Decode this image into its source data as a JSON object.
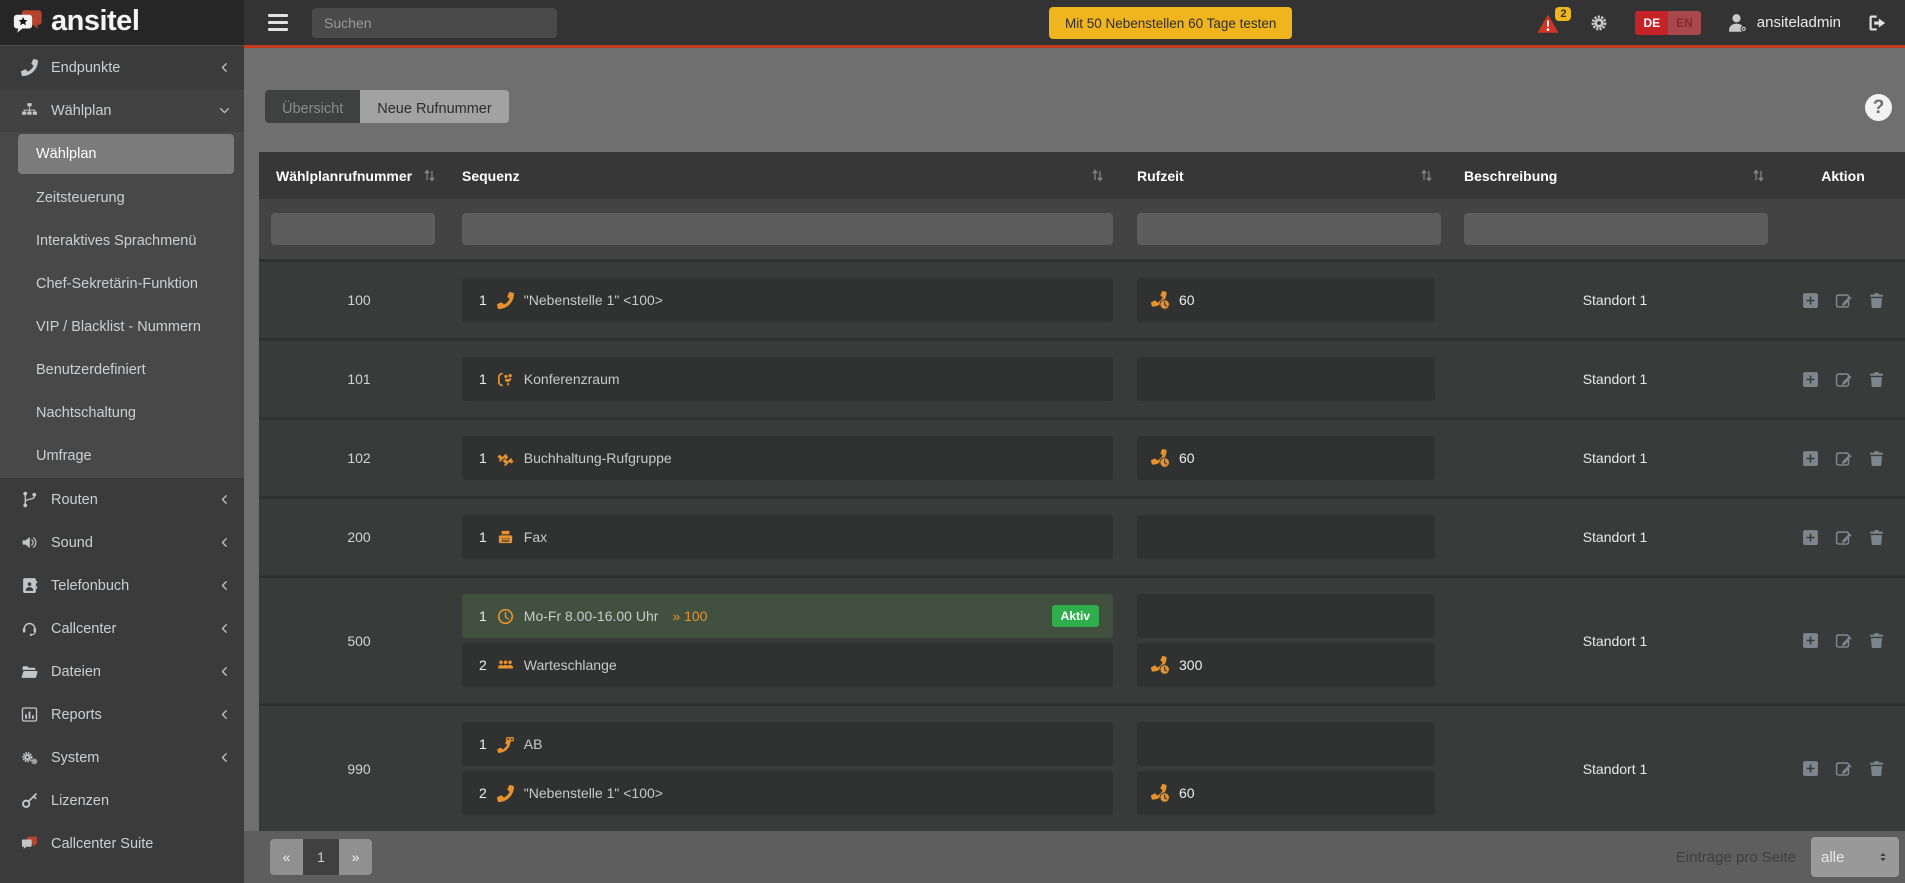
{
  "topbar": {
    "logo_text": "ansitel",
    "search_placeholder": "Suchen",
    "trial_button_label": "Mit 50 Nebenstellen 60 Tage testen",
    "warning_badge": "2",
    "lang": {
      "de": "DE",
      "en": "EN"
    },
    "username": "ansiteladmin"
  },
  "sidebar": {
    "items_top": [
      {
        "label": "Endpunkte",
        "icon": "phone-icon"
      },
      {
        "label": "Wählplan",
        "icon": "sitemap-icon"
      }
    ],
    "submenu": [
      {
        "label": "Wählplan",
        "active": true
      },
      {
        "label": "Zeitsteuerung"
      },
      {
        "label": "Interaktives Sprachmenü"
      },
      {
        "label": "Chef-Sekretärin-Funktion"
      },
      {
        "label": "VIP / Blacklist - Nummern"
      },
      {
        "label": "Benutzerdefiniert"
      },
      {
        "label": "Nachtschaltung"
      },
      {
        "label": "Umfrage"
      }
    ],
    "items_bottom": [
      {
        "label": "Routen",
        "icon": "code-branch-icon"
      },
      {
        "label": "Sound",
        "icon": "volume-icon"
      },
      {
        "label": "Telefonbuch",
        "icon": "address-book-icon"
      },
      {
        "label": "Callcenter",
        "icon": "headset-icon"
      },
      {
        "label": "Dateien",
        "icon": "folder-open-icon"
      },
      {
        "label": "Reports",
        "icon": "bar-chart-icon"
      },
      {
        "label": "System",
        "icon": "cogs-icon"
      },
      {
        "label": "Lizenzen",
        "icon": "key-icon"
      },
      {
        "label": "Callcenter Suite",
        "icon": "comments-icon"
      }
    ]
  },
  "tabs": {
    "overview": "Übersicht",
    "new_number": "Neue Rufnummer"
  },
  "help_label": "?",
  "table": {
    "headers": {
      "number": "Wählplanrufnummer",
      "sequence": "Sequenz",
      "ringtime": "Rufzeit",
      "description": "Beschreibung",
      "action": "Aktion"
    },
    "rows": [
      {
        "number": "100",
        "description": "Standort 1",
        "sequences": [
          {
            "step": "1",
            "icon": "phone-receiver-icon",
            "text": "\"Nebenstelle 1\" <100>",
            "ringtime": "60"
          }
        ]
      },
      {
        "number": "101",
        "description": "Standort 1",
        "sequences": [
          {
            "step": "1",
            "icon": "conference-icon",
            "text": "Konferenzraum",
            "ringtime": ""
          }
        ]
      },
      {
        "number": "102",
        "description": "Standort 1",
        "sequences": [
          {
            "step": "1",
            "icon": "ring-group-icon",
            "text": "Buchhaltung-Rufgruppe",
            "ringtime": "60"
          }
        ]
      },
      {
        "number": "200",
        "description": "Standort 1",
        "sequences": [
          {
            "step": "1",
            "icon": "fax-icon",
            "text": "Fax",
            "ringtime": ""
          }
        ]
      },
      {
        "number": "500",
        "description": "Standort 1",
        "sequences": [
          {
            "step": "1",
            "icon": "clock-icon",
            "text": "Mo-Fr 8.00-16.00 Uhr",
            "target": "» 100",
            "badge": "Aktiv",
            "active": true,
            "ringtime": ""
          },
          {
            "step": "2",
            "icon": "queue-users-icon",
            "text": "Warteschlange",
            "ringtime": "300"
          }
        ]
      },
      {
        "number": "990",
        "description": "Standort 1",
        "sequences": [
          {
            "step": "1",
            "icon": "voicemail-icon",
            "text": "AB",
            "ringtime": ""
          },
          {
            "step": "2",
            "icon": "phone-receiver-icon",
            "text": "\"Nebenstelle 1\" <100>",
            "ringtime": "60"
          }
        ]
      }
    ],
    "action_icons": [
      "plus-square-icon",
      "edit-icon",
      "trash-icon"
    ],
    "ringtime_icon": "phone-clock-icon",
    "sort_icon": "sort-arrows-icon"
  },
  "pagination": {
    "prev": "«",
    "page": "1",
    "next": "»",
    "per_page_label": "Einträge pro Seite",
    "per_page_value": "alle"
  },
  "colors": {
    "accent_orange": "#e8922e",
    "active_sequence_green": "#42503f",
    "aktiv_badge_green": "#2fae4e",
    "header_red_line": "#c23b1d",
    "trial_button_yellow": "#efb41e",
    "warning_red": "#cf3526",
    "lang_active_red": "#c62328"
  }
}
